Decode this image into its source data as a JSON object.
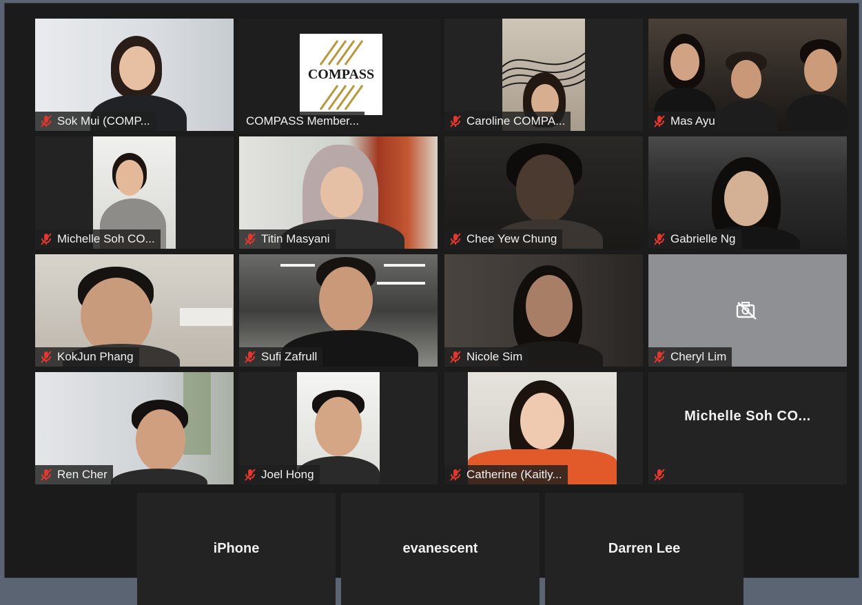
{
  "meeting": {
    "participants": [
      {
        "id": "sok-mui",
        "name": "Sok Mui (COMP...",
        "muted": true
      },
      {
        "id": "compass-member",
        "name": "COMPASS Member...",
        "muted": false,
        "active_speaker": true,
        "logo_text": "COMPASS"
      },
      {
        "id": "caroline",
        "name": "Caroline COMPA...",
        "muted": true
      },
      {
        "id": "mas-ayu",
        "name": "Mas Ayu",
        "muted": true
      },
      {
        "id": "michelle-soh",
        "name": "Michelle Soh CO...",
        "muted": true
      },
      {
        "id": "titin-masyani",
        "name": "Titin Masyani",
        "muted": true
      },
      {
        "id": "chee-yew-chung",
        "name": "Chee Yew Chung",
        "muted": true
      },
      {
        "id": "gabrielle-ng",
        "name": "Gabrielle Ng",
        "muted": true
      },
      {
        "id": "kokjun-phang",
        "name": "KokJun Phang",
        "muted": true
      },
      {
        "id": "sufi-zafrull",
        "name": "Sufi Zafrull",
        "muted": true
      },
      {
        "id": "nicole-sim",
        "name": "Nicole Sim",
        "muted": true
      },
      {
        "id": "cheryl-lim",
        "name": "Cheryl Lim",
        "muted": true,
        "video_off": true
      },
      {
        "id": "ren-cher",
        "name": "Ren Cher",
        "muted": true
      },
      {
        "id": "joel-hong",
        "name": "Joel Hong",
        "muted": true
      },
      {
        "id": "catherine",
        "name": "Catherine (Kaitly...",
        "muted": true
      },
      {
        "id": "michelle-soh-2",
        "name": "Michelle  Soh  CO...",
        "muted": true,
        "video_off": true,
        "name_only": true
      }
    ],
    "bottom_row": [
      {
        "id": "iphone",
        "name": "iPhone"
      },
      {
        "id": "evanescent",
        "name": "evanescent"
      },
      {
        "id": "darren-lee",
        "name": "Darren Lee"
      }
    ]
  },
  "colors": {
    "active_speaker_border": "#c9df7a",
    "muted_mic": "#e0382f",
    "tile_background": "#232323"
  },
  "icons": {
    "muted": "mic-muted-icon",
    "camera_off": "camera-off-icon"
  }
}
